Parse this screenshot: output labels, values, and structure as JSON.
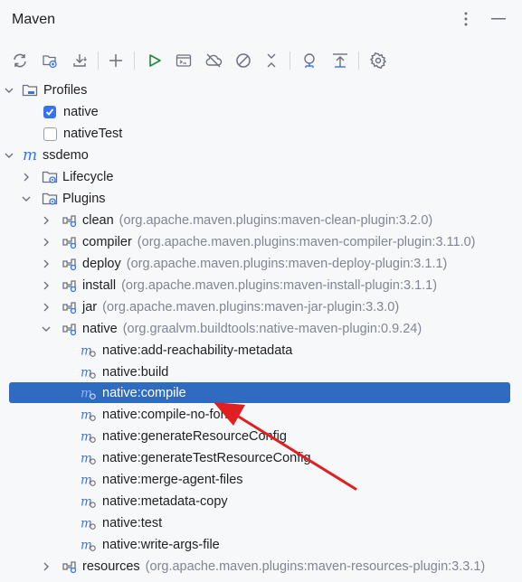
{
  "window": {
    "title": "Maven"
  },
  "header_actions": [
    {
      "name": "options-menu-icon"
    },
    {
      "name": "minimize-icon"
    }
  ],
  "toolbar": [
    {
      "name": "reload-all-projects-icon"
    },
    {
      "name": "generate-sources-icon"
    },
    {
      "name": "download-sources-icon"
    },
    {
      "name": "add-maven-project-icon"
    },
    {
      "name": "run-maven-build-icon"
    },
    {
      "name": "execute-maven-goal-icon"
    },
    {
      "name": "toggle-offline-mode-icon"
    },
    {
      "name": "skip-tests-icon"
    },
    {
      "name": "collapse-all-icon"
    },
    {
      "name": "show-dependencies-icon"
    },
    {
      "name": "analyze-dependencies-icon"
    },
    {
      "name": "maven-settings-icon"
    }
  ],
  "tree": {
    "profiles": {
      "label": "Profiles",
      "items": [
        {
          "label": "native",
          "checked": true
        },
        {
          "label": "nativeTest",
          "checked": false
        }
      ]
    },
    "project": {
      "label": "ssdemo",
      "lifecycle_label": "Lifecycle",
      "plugins_label": "Plugins",
      "plugins": [
        {
          "label": "clean",
          "coords": "(org.apache.maven.plugins:maven-clean-plugin:3.2.0)"
        },
        {
          "label": "compiler",
          "coords": "(org.apache.maven.plugins:maven-compiler-plugin:3.11.0)"
        },
        {
          "label": "deploy",
          "coords": "(org.apache.maven.plugins:maven-deploy-plugin:3.1.1)"
        },
        {
          "label": "install",
          "coords": "(org.apache.maven.plugins:maven-install-plugin:3.1.1)"
        },
        {
          "label": "jar",
          "coords": "(org.apache.maven.plugins:maven-jar-plugin:3.3.0)"
        },
        {
          "label": "native",
          "coords": "(org.graalvm.buildtools:native-maven-plugin:0.9.24)"
        }
      ],
      "native_goals": [
        "native:add-reachability-metadata",
        "native:build",
        "native:compile",
        "native:compile-no-fork",
        "native:generateResourceConfig",
        "native:generateTestResourceConfig",
        "native:merge-agent-files",
        "native:metadata-copy",
        "native:test",
        "native:write-args-file"
      ],
      "selected_goal": "native:compile",
      "trailing_plugin": {
        "label": "resources",
        "coords": "(org.apache.maven.plugins:maven-resources-plugin:3.3.1)"
      }
    }
  },
  "colors": {
    "selection": "#2f6bc1",
    "accent": "#3574f0",
    "annotation_arrow": "#e02020"
  }
}
